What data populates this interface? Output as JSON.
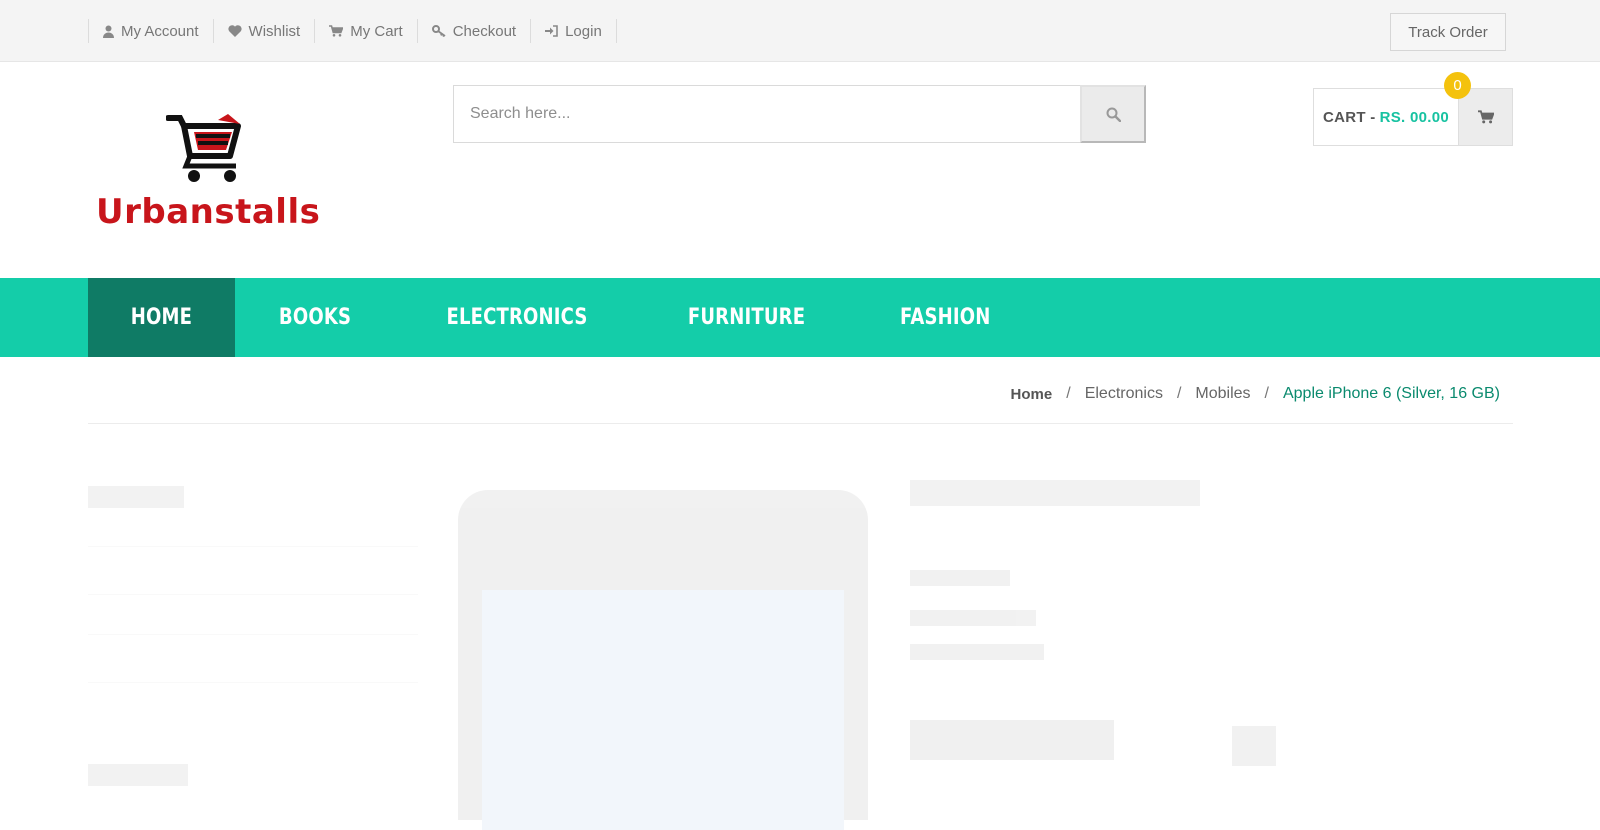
{
  "topbar": {
    "links": [
      {
        "label": "My Account",
        "icon": "user-icon"
      },
      {
        "label": "Wishlist",
        "icon": "heart-icon"
      },
      {
        "label": "My Cart",
        "icon": "cart-icon"
      },
      {
        "label": "Checkout",
        "icon": "key-icon"
      },
      {
        "label": "Login",
        "icon": "sign-in-icon"
      }
    ],
    "track_order": "Track Order"
  },
  "header": {
    "logo_text": "Urbanstalls",
    "search": {
      "placeholder": "Search here..."
    },
    "cart": {
      "label": "CART -",
      "amount": "RS. 00.00",
      "count": "0"
    }
  },
  "nav": {
    "items": [
      "HOME",
      "BOOKS",
      "ELECTRONICS",
      "FURNITURE",
      "FASHION"
    ],
    "active": "HOME"
  },
  "breadcrumb": {
    "home": "Home",
    "items": [
      "Electronics",
      "Mobiles"
    ],
    "current": "Apple iPhone 6 (Silver, 16 GB)"
  },
  "colors": {
    "accent": "#14cda9",
    "nav_active": "#0f7b65",
    "brand_red": "#c8151b",
    "badge": "#f4c20d"
  }
}
